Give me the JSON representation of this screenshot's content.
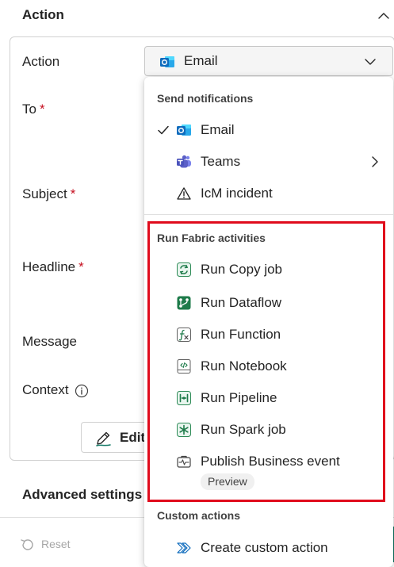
{
  "section": {
    "title": "Action"
  },
  "form": {
    "action_label": "Action",
    "to_label": "To",
    "subject_label": "Subject",
    "headline_label": "Headline",
    "message_label": "Message",
    "context_label": "Context",
    "required_mark": "*",
    "edit_button": "Edit"
  },
  "action_select": {
    "value": "Email",
    "icon": "outlook-icon"
  },
  "advanced": {
    "title": "Advanced settings"
  },
  "footer": {
    "reset_label": "Reset"
  },
  "menu": {
    "groups": [
      {
        "label": "Send notifications",
        "items": [
          {
            "label": "Email",
            "icon": "outlook-icon",
            "selected": true
          },
          {
            "label": "Teams",
            "icon": "teams-icon",
            "has_submenu": true
          },
          {
            "label": "IcM incident",
            "icon": "warning-icon"
          }
        ]
      },
      {
        "label": "Run Fabric activities",
        "items": [
          {
            "label": "Run Copy job",
            "icon": "copy-job-icon"
          },
          {
            "label": "Run Dataflow",
            "icon": "dataflow-icon"
          },
          {
            "label": "Run Function",
            "icon": "function-icon"
          },
          {
            "label": "Run Notebook",
            "icon": "notebook-icon"
          },
          {
            "label": "Run Pipeline",
            "icon": "pipeline-icon"
          },
          {
            "label": "Run Spark job",
            "icon": "spark-job-icon"
          },
          {
            "label": "Publish Business event",
            "icon": "business-event-icon",
            "badge": "Preview"
          }
        ]
      },
      {
        "label": "Custom actions",
        "items": [
          {
            "label": "Create custom action",
            "icon": "custom-action-icon"
          }
        ]
      }
    ]
  },
  "colors": {
    "required": "#c50f1f",
    "highlight": "#e00b1c",
    "fabric_green": "#117865",
    "outlook_blue": "#0f6cbd",
    "teams_purple": "#5b5fc7"
  }
}
